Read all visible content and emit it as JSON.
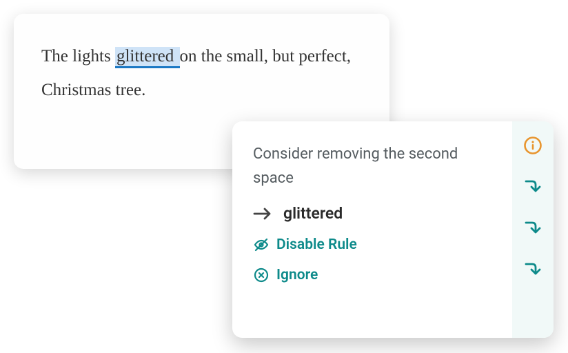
{
  "editor": {
    "before": "The lights ",
    "flagged": "glittered ",
    "after": " on the small, but perfect, Christmas tree."
  },
  "suggestion": {
    "title": "Consider removing the second space",
    "replacement": "glittered",
    "disable_label": "Disable Rule",
    "ignore_label": "Ignore"
  }
}
